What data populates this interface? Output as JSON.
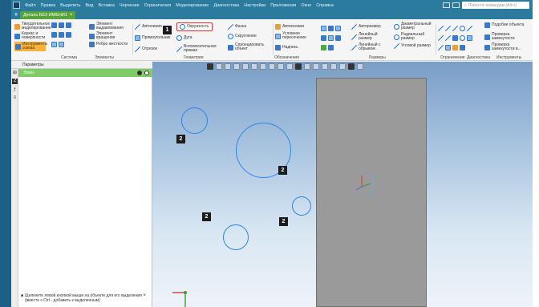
{
  "titlebar": {
    "menu": [
      "Файл",
      "Правка",
      "Выделить",
      "Вид",
      "Вставка",
      "Черчение",
      "Ограничения",
      "Моделирование",
      "Диагностика",
      "Настройки",
      "Приложения",
      "Окно",
      "Справка"
    ],
    "search_placeholder": "Поиск по командам (Alt+/)"
  },
  "tab": {
    "label": "Деталь БЕЗ ИМЕНИ1",
    "close": "×"
  },
  "ribbon": {
    "col1": [
      "Твердотельное моделирование",
      "Каркас и поверхности",
      "Инструменты эскиза"
    ],
    "col2": [
      "Элемент выдавливания",
      "Элемент вращения",
      "Ребро жесткости"
    ],
    "col3": [
      "Автолиния",
      "Прямоугольник",
      "Отрезок"
    ],
    "group_sketch": [
      "Окружность",
      "Дуга",
      "Вспомогательная прямая"
    ],
    "group_sketch2": [
      "Фаска",
      "Скругление",
      "Спроецировать объект"
    ],
    "auto": [
      "Автоосевая",
      "Условное пересечение",
      "Надпись"
    ],
    "sizes": [
      "Авторазмер",
      "Линейный размер",
      "Линейный с обрывом"
    ],
    "sizes2": [
      "Диаметральный размер",
      "Радиальный размер",
      "Угловой размер"
    ],
    "right": [
      "Подобие объекта",
      "Проверка замкнутости",
      "Проверка замкнутости в..."
    ],
    "group_labels": [
      "Система",
      "Элементы",
      "Геометрия",
      "Обозначения",
      "Размеры",
      "Ограничения",
      "Диагностика",
      "Инструменты"
    ]
  },
  "panel": {
    "title": "Параметры",
    "tree_item": "Эскиз",
    "hint": "Щелкните левой кнопкой мыши на объекте для его выделения (вместе с Ctrl - добавить к выделенным)"
  },
  "badges": {
    "step1": "1",
    "count": "2"
  },
  "colors": {
    "accent": "#2a7b9e",
    "tab": "#5aa33a",
    "circle": "#2a86e8",
    "highlight": "#e23030"
  }
}
